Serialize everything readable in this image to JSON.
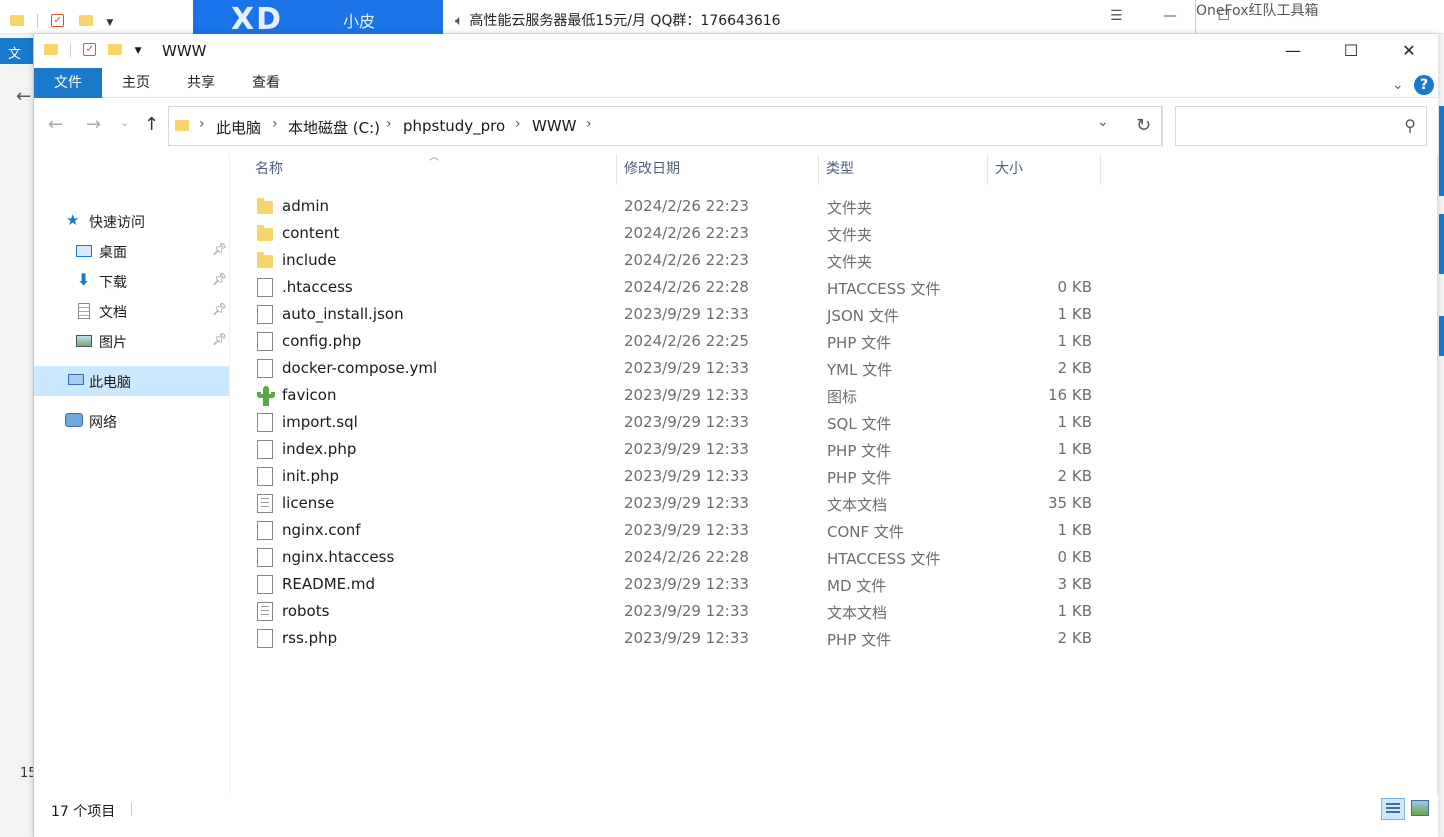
{
  "background": {
    "banner_big": "XD",
    "banner_small": "小皮",
    "ad_text": "高性能云服务器最低15元/月  QQ群：176643616",
    "other_window_title": "OneFox红队工具箱",
    "left_tab_label": "文",
    "left_number": "15"
  },
  "window": {
    "title": "WWW",
    "minimize": "—",
    "maximize": "☐",
    "close": "✕"
  },
  "ribbon": {
    "tabs": [
      "文件",
      "主页",
      "共享",
      "查看"
    ],
    "help": "?"
  },
  "address": {
    "segments": [
      "此电脑",
      "本地磁盘 (C:)",
      "phpstudy_pro",
      "WWW"
    ],
    "search_placeholder": ""
  },
  "sidebar": {
    "items": [
      {
        "label": "快速访问",
        "icon": "star-icon"
      },
      {
        "label": "桌面",
        "icon": "desktop-icon",
        "pinned": true
      },
      {
        "label": "下载",
        "icon": "download-icon",
        "pinned": true
      },
      {
        "label": "文档",
        "icon": "document-icon",
        "pinned": true
      },
      {
        "label": "图片",
        "icon": "pictures-icon",
        "pinned": true
      },
      {
        "label": "此电脑",
        "icon": "computer-icon",
        "selected": true
      },
      {
        "label": "网络",
        "icon": "network-icon"
      }
    ]
  },
  "columns": [
    "名称",
    "修改日期",
    "类型",
    "大小"
  ],
  "files": [
    {
      "name": "admin",
      "date": "2024/2/26 22:23",
      "type": "文件夹",
      "size": "",
      "icon": "folder"
    },
    {
      "name": "content",
      "date": "2024/2/26 22:23",
      "type": "文件夹",
      "size": "",
      "icon": "folder"
    },
    {
      "name": "include",
      "date": "2024/2/26 22:23",
      "type": "文件夹",
      "size": "",
      "icon": "folder"
    },
    {
      "name": ".htaccess",
      "date": "2024/2/26 22:28",
      "type": "HTACCESS 文件",
      "size": "0 KB",
      "icon": "file"
    },
    {
      "name": "auto_install.json",
      "date": "2023/9/29 12:33",
      "type": "JSON 文件",
      "size": "1 KB",
      "icon": "file"
    },
    {
      "name": "config.php",
      "date": "2024/2/26 22:25",
      "type": "PHP 文件",
      "size": "1 KB",
      "icon": "file"
    },
    {
      "name": "docker-compose.yml",
      "date": "2023/9/29 12:33",
      "type": "YML 文件",
      "size": "2 KB",
      "icon": "file"
    },
    {
      "name": "favicon",
      "date": "2023/9/29 12:33",
      "type": "图标",
      "size": "16 KB",
      "icon": "cactus"
    },
    {
      "name": "import.sql",
      "date": "2023/9/29 12:33",
      "type": "SQL 文件",
      "size": "1 KB",
      "icon": "file"
    },
    {
      "name": "index.php",
      "date": "2023/9/29 12:33",
      "type": "PHP 文件",
      "size": "1 KB",
      "icon": "file"
    },
    {
      "name": "init.php",
      "date": "2023/9/29 12:33",
      "type": "PHP 文件",
      "size": "2 KB",
      "icon": "file"
    },
    {
      "name": "license",
      "date": "2023/9/29 12:33",
      "type": "文本文档",
      "size": "35 KB",
      "icon": "text"
    },
    {
      "name": "nginx.conf",
      "date": "2023/9/29 12:33",
      "type": "CONF 文件",
      "size": "1 KB",
      "icon": "file"
    },
    {
      "name": "nginx.htaccess",
      "date": "2024/2/26 22:28",
      "type": "HTACCESS 文件",
      "size": "0 KB",
      "icon": "file"
    },
    {
      "name": "README.md",
      "date": "2023/9/29 12:33",
      "type": "MD 文件",
      "size": "3 KB",
      "icon": "file"
    },
    {
      "name": "robots",
      "date": "2023/9/29 12:33",
      "type": "文本文档",
      "size": "1 KB",
      "icon": "text"
    },
    {
      "name": "rss.php",
      "date": "2023/9/29 12:33",
      "type": "PHP 文件",
      "size": "2 KB",
      "icon": "file"
    }
  ],
  "status": {
    "count": "17 个项目"
  }
}
